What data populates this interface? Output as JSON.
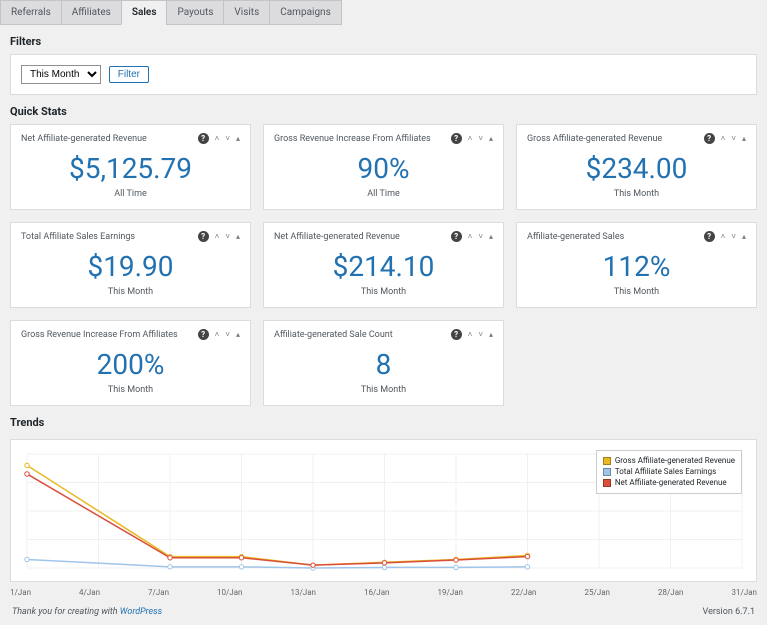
{
  "tabs": [
    "Referrals",
    "Affiliates",
    "Sales",
    "Payouts",
    "Visits",
    "Campaigns"
  ],
  "active_tab": "Sales",
  "filters": {
    "title": "Filters",
    "select_value": "This Month",
    "button_label": "Filter"
  },
  "quick_stats": {
    "title": "Quick Stats",
    "cards": [
      {
        "title": "Net Affiliate-generated Revenue",
        "value": "$5,125.79",
        "sub": "All Time"
      },
      {
        "title": "Gross Revenue Increase From Affiliates",
        "value": "90%",
        "sub": "All Time"
      },
      {
        "title": "Gross Affiliate-generated Revenue",
        "value": "$234.00",
        "sub": "This Month"
      },
      {
        "title": "Total Affiliate Sales Earnings",
        "value": "$19.90",
        "sub": "This Month"
      },
      {
        "title": "Net Affiliate-generated Revenue",
        "value": "$214.10",
        "sub": "This Month"
      },
      {
        "title": "Affiliate-generated Sales",
        "value": "112%",
        "sub": "This Month"
      },
      {
        "title": "Gross Revenue Increase From Affiliates",
        "value": "200%",
        "sub": "This Month"
      },
      {
        "title": "Affiliate-generated Sale Count",
        "value": "8",
        "sub": "This Month"
      }
    ]
  },
  "trends": {
    "title": "Trends",
    "legend": {
      "gross": "Gross Affiliate-generated Revenue",
      "total": "Total Affiliate Sales Earnings",
      "net": "Net Affiliate-generated Revenue"
    }
  },
  "chart_data": {
    "type": "line",
    "x_labels": [
      "1/Jan",
      "4/Jan",
      "7/Jan",
      "10/Jan",
      "13/Jan",
      "16/Jan",
      "19/Jan",
      "22/Jan",
      "25/Jan",
      "28/Jan",
      "31/Jan"
    ],
    "x": [
      1,
      4,
      7,
      10,
      13,
      16,
      19,
      22,
      25,
      28,
      31
    ],
    "ylim": [
      0,
      200
    ],
    "series": [
      {
        "name": "Gross Affiliate-generated Revenue",
        "color": "#e8b923",
        "x": [
          1,
          7,
          10,
          13,
          16,
          19,
          22
        ],
        "y": [
          180,
          20,
          20,
          5,
          10,
          15,
          22
        ]
      },
      {
        "name": "Total Affiliate Sales Earnings",
        "color": "#9fc5e8",
        "x": [
          1,
          7,
          10,
          13,
          16,
          19,
          22
        ],
        "y": [
          15,
          2,
          2,
          0,
          1,
          1,
          2
        ]
      },
      {
        "name": "Net Affiliate-generated Revenue",
        "color": "#d94f3a",
        "x": [
          1,
          7,
          10,
          13,
          16,
          19,
          22
        ],
        "y": [
          165,
          18,
          18,
          5,
          9,
          14,
          20
        ]
      }
    ]
  },
  "colors": {
    "gross": "#e8b923",
    "total": "#9fc5e8",
    "net": "#d94f3a"
  },
  "footer": {
    "thanks_prefix": "Thank you for creating with ",
    "thanks_link": "WordPress",
    "version": "Version 6.7.1"
  }
}
